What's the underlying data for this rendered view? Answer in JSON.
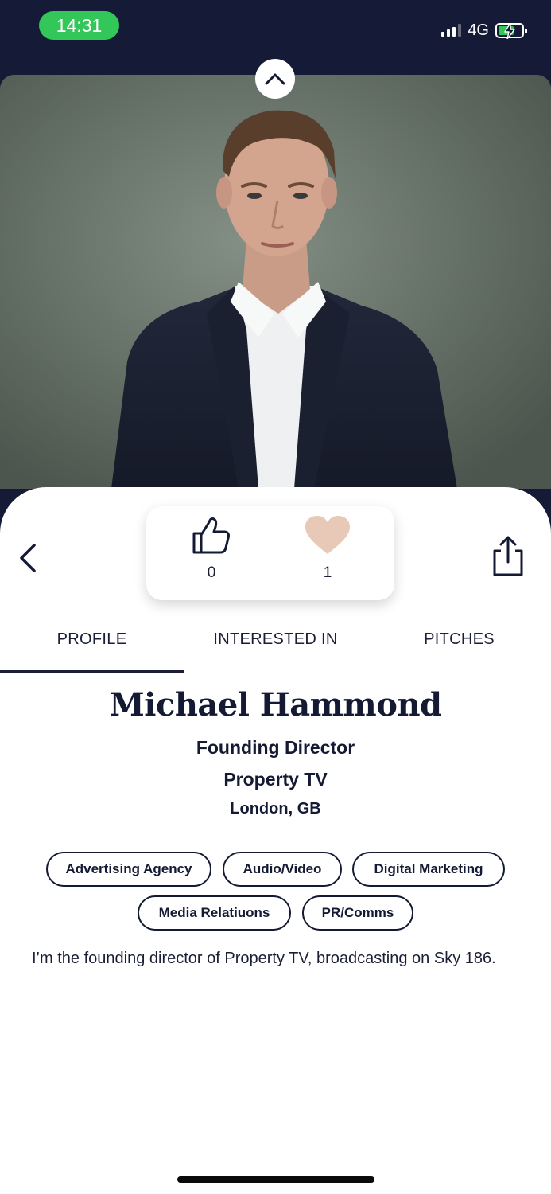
{
  "status_bar": {
    "time": "14:31",
    "network": "4G",
    "signal_bars_active": 3,
    "signal_bars_total": 4,
    "battery_level_fraction": 0.58,
    "battery_charging": true,
    "colors": {
      "time_pill": "#33c759",
      "bar_bg": "#151a36"
    }
  },
  "profile_photo": {
    "description_icon": "profile-photo",
    "background_color": "#5f6b61"
  },
  "actions": {
    "collapse_icon": "chevron-up-icon",
    "back_icon": "chevron-left-icon",
    "share_icon": "share-icon"
  },
  "reactions": {
    "likes": {
      "icon": "thumbs-up-icon",
      "count": "0"
    },
    "favorites": {
      "icon": "heart-icon",
      "count": "1",
      "color": "#e8c9b8"
    }
  },
  "tabs": [
    {
      "label": "PROFILE",
      "active": true
    },
    {
      "label": "INTERESTED IN",
      "active": false
    },
    {
      "label": "PITCHES",
      "active": false
    }
  ],
  "profile": {
    "name": "Michael Hammond",
    "role": "Founding Director",
    "company": "Property TV",
    "location": "London, GB",
    "tags": [
      "Advertising Agency",
      "Audio/Video",
      "Digital Marketing",
      "Media Relatiuons",
      "PR/Comms"
    ],
    "bio": "I’m the founding director of Property TV, broadcasting on Sky 186."
  }
}
